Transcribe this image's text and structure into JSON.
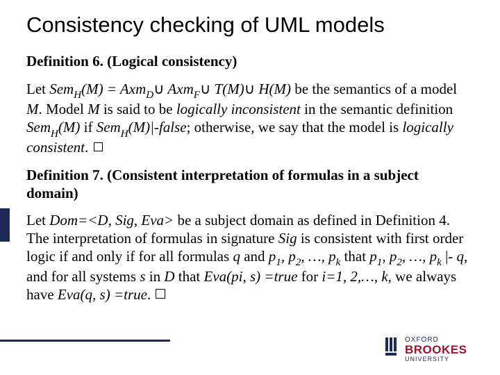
{
  "title": "Consistency checking of UML models",
  "def6_heading": "Definition 6. (Logical consistency)",
  "def6_p1": "Let ",
  "def6_p2": "Sem",
  "def6_sub_h1": "H",
  "def6_p3": "(M) = Axm",
  "def6_sub_d": "D",
  "def6_cup1": "∪",
  "def6_p4": " Axm",
  "def6_sub_f": "F",
  "def6_cup2": "∪",
  "def6_p5": " T(M)",
  "def6_cup3": "∪",
  "def6_p6": " H(M)",
  "def6_p7": " be the semantics of a model ",
  "def6_m1": "M",
  "def6_p8": ". Model ",
  "def6_m2": "M",
  "def6_p9": " is said to be ",
  "def6_li": "logically inconsistent",
  "def6_p10": " in the semantic definition ",
  "def6_sem2": "Sem",
  "def6_sub_h2": "H",
  "def6_p11": "(M)",
  "def6_p12": " if ",
  "def6_sem3": "Sem",
  "def6_sub_h3": "H",
  "def6_p13": "(M)|-false",
  "def6_p14": "; otherwise, we say that the model is ",
  "def6_lc": "logically consistent",
  "def6_p15": ". ",
  "def7_heading": "Definition 7. (Consistent interpretation of formulas in a subject domain)",
  "def7_p1": "Let ",
  "def7_dom": "Dom=<D, Sig, Eva>",
  "def7_p2": " be a subject domain as defined in Definition 4. The interpretation of formulas in signature ",
  "def7_sig": "Sig",
  "def7_p3": " is consistent with first order logic if and only if for all formulas ",
  "def7_q": "q",
  "def7_p4": " and ",
  "def7_plist1_a": "p",
  "def7_s1": "1",
  "def7_plist1_b": ", p",
  "def7_s2": "2",
  "def7_plist1_c": ", …, p",
  "def7_sk": "k",
  "def7_p5": " that ",
  "def7_plist2_a": "p",
  "def7_plist2_c": ", …, p",
  "def7_p6": " |- ",
  "def7_q2": "q",
  "def7_p7": ", and for all systems ",
  "def7_s": "s",
  "def7_p8": " in ",
  "def7_D": "D",
  "def7_p9": " that ",
  "def7_eva1": "Eva(pi, s) =true",
  "def7_p10": " for ",
  "def7_ilist": "i=1, 2,…, k",
  "def7_p11": ", we always have ",
  "def7_eva2": "Eva(q, s) =true",
  "def7_p12": ". ",
  "logo_l1": "OXFORD",
  "logo_l2": "BROOKES",
  "logo_l3": "UNIVERSITY"
}
